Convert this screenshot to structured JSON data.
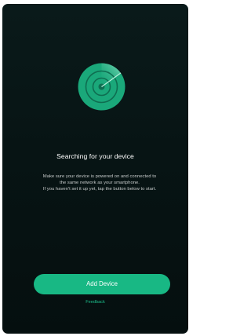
{
  "search_screen": {
    "title": "Searching for your device",
    "description_lines": [
      "Make sure your device is powered on and connected to",
      "the same network as your smartphone.",
      "If you haven't set it up yet, tap the button below to start."
    ],
    "add_device_label": "Add Device",
    "feedback_label": "Feedback"
  },
  "icons": {
    "radar": "radar-scan-icon"
  },
  "colors": {
    "background": "#071414",
    "accent": "#18b884",
    "radar_fill": "#1aa87a",
    "text_primary": "#ffffff",
    "text_secondary": "#c7cbcb"
  }
}
